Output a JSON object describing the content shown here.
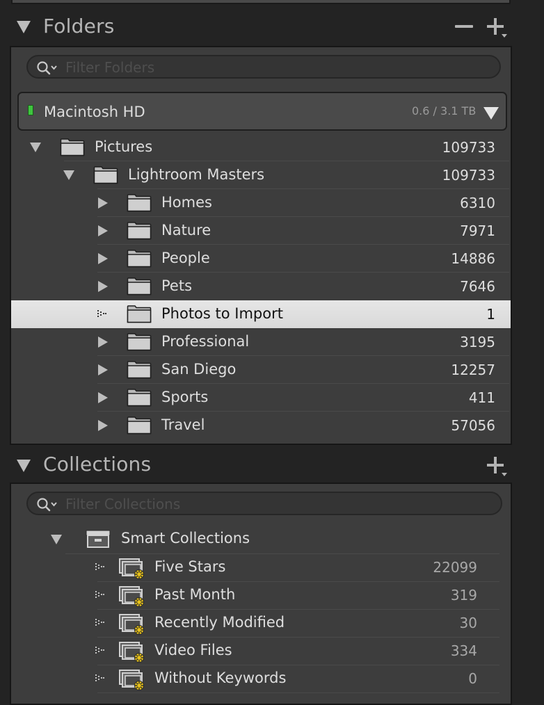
{
  "folders_panel": {
    "title": "Folders",
    "minus_symbol": "−",
    "plus_symbol": "+",
    "filter_placeholder": "Filter Folders",
    "volume": {
      "name": "Macintosh HD",
      "usage": "0.6 / 3.1 TB",
      "status_color": "#3fc43f"
    },
    "tree": [
      {
        "label": "Pictures",
        "count": "109733",
        "state": "expanded",
        "level": 0
      },
      {
        "label": "Lightroom Masters",
        "count": "109733",
        "state": "expanded",
        "level": 1
      },
      {
        "label": "Homes",
        "count": "6310",
        "state": "collapsed",
        "level": 2
      },
      {
        "label": "Nature",
        "count": "7971",
        "state": "collapsed",
        "level": 2
      },
      {
        "label": "People",
        "count": "14886",
        "state": "collapsed",
        "level": 2
      },
      {
        "label": "Pets",
        "count": "7646",
        "state": "collapsed",
        "level": 2
      },
      {
        "label": "Photos to Import",
        "count": "1",
        "state": "leaf",
        "level": 2,
        "selected": true
      },
      {
        "label": "Professional",
        "count": "3195",
        "state": "collapsed",
        "level": 2
      },
      {
        "label": "San Diego",
        "count": "12257",
        "state": "collapsed",
        "level": 2
      },
      {
        "label": "Sports",
        "count": "411",
        "state": "collapsed",
        "level": 2
      },
      {
        "label": "Travel",
        "count": "57056",
        "state": "collapsed",
        "level": 2
      }
    ]
  },
  "collections_panel": {
    "title": "Collections",
    "plus_symbol": "+",
    "filter_placeholder": "Filter Collections",
    "set": {
      "label": "Smart Collections"
    },
    "items": [
      {
        "label": "Five Stars",
        "count": "22099"
      },
      {
        "label": "Past Month",
        "count": "319"
      },
      {
        "label": "Recently Modified",
        "count": "30"
      },
      {
        "label": "Video Files",
        "count": "334"
      },
      {
        "label": "Without Keywords",
        "count": "0"
      }
    ]
  },
  "colors": {
    "panel_bg": "#3d3d3d",
    "selected_row_bg": "#e2e2e2",
    "smart_badge": "#e8c21a"
  }
}
